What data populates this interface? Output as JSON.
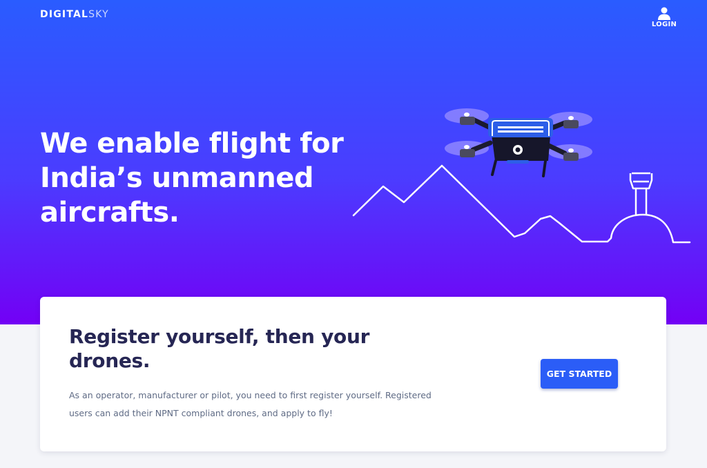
{
  "header": {
    "logo_primary": "DIGITAL",
    "logo_secondary": "SKY",
    "login_label": "LOGIN",
    "login_icon": "user-icon"
  },
  "hero": {
    "headline_line1": "We enable flight for",
    "headline_line2": "India’s unmanned",
    "headline_line3": "aircrafts.",
    "illustration_icons": [
      "drone-icon",
      "mountain-line-icon",
      "control-tower-icon"
    ]
  },
  "card": {
    "title_line1": "Register yourself, then your",
    "title_line2": "drones.",
    "body_line1": "As an operator, manufacturer or pilot, you need to first register yourself. Registered",
    "body_line2": "users can add their NPNT compliant drones, and apply to fly!",
    "cta_label": "GET STARTED"
  },
  "colors": {
    "hero_gradient_top": "#2a5cff",
    "hero_gradient_bottom": "#7300f5",
    "button": "#2b5df7",
    "card_title": "#262654",
    "card_body": "#5f6b85",
    "page_background": "#f4f5f9"
  }
}
